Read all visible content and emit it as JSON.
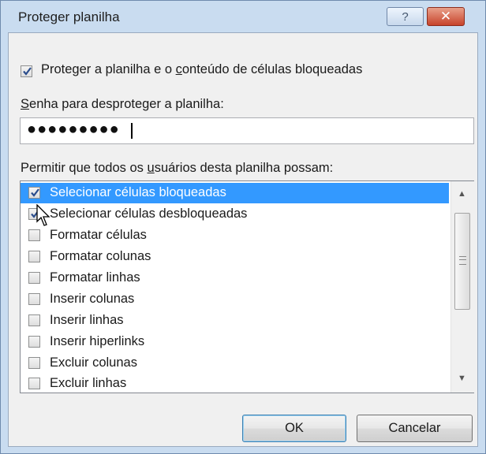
{
  "window": {
    "title": "Proteger planilha",
    "help_glyph": "?",
    "close_glyph": "✕"
  },
  "protect": {
    "checked": true,
    "label_before": "Proteger a planilha e o ",
    "label_underlined": "c",
    "label_after": "onteúdo de células bloqueadas"
  },
  "password": {
    "label_underlined": "S",
    "label_after": "enha para desproteger a planilha:",
    "value_masked": "●●●●●●●●●"
  },
  "permissions": {
    "label_before": "Permitir que todos os ",
    "label_underlined": "u",
    "label_after": "suários desta planilha possam:",
    "items": [
      {
        "label": "Selecionar células bloqueadas",
        "checked": true,
        "selected": true
      },
      {
        "label": "Selecionar células desbloqueadas",
        "checked": true,
        "selected": false
      },
      {
        "label": "Formatar células",
        "checked": false,
        "selected": false
      },
      {
        "label": "Formatar colunas",
        "checked": false,
        "selected": false
      },
      {
        "label": "Formatar linhas",
        "checked": false,
        "selected": false
      },
      {
        "label": "Inserir colunas",
        "checked": false,
        "selected": false
      },
      {
        "label": "Inserir linhas",
        "checked": false,
        "selected": false
      },
      {
        "label": "Inserir hiperlinks",
        "checked": false,
        "selected": false
      },
      {
        "label": "Excluir colunas",
        "checked": false,
        "selected": false
      },
      {
        "label": "Excluir linhas",
        "checked": false,
        "selected": false
      }
    ]
  },
  "buttons": {
    "ok": "OK",
    "cancel": "Cancelar"
  },
  "icons": {
    "help": "help-icon",
    "close": "close-icon",
    "check": "check-icon",
    "scroll_up": "scroll-up-arrow-icon",
    "scroll_down": "scroll-down-arrow-icon",
    "cursor": "mouse-pointer-icon"
  }
}
